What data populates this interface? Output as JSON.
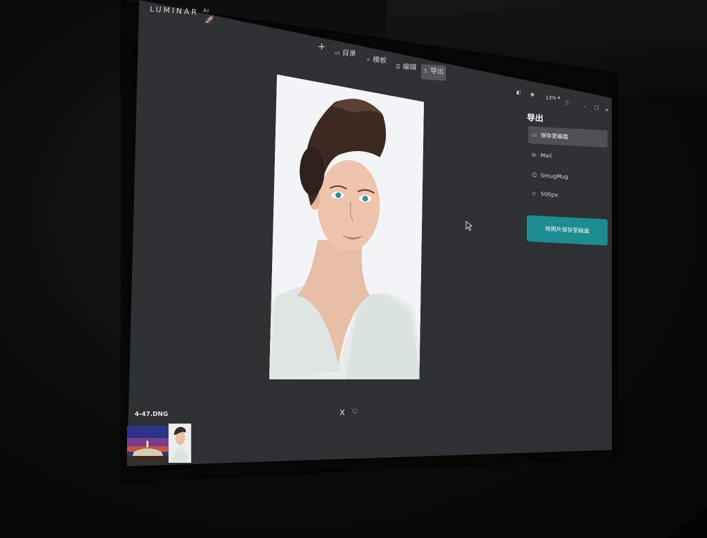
{
  "app": {
    "brand": "LUMINAR",
    "brand_suffix": "AI"
  },
  "nav": {
    "plus": "+",
    "catalog": "目录",
    "template": "模板",
    "edit": "编辑",
    "export": "导出"
  },
  "window_controls": {
    "zoom": "13%"
  },
  "export_panel": {
    "title": "导出",
    "options": [
      {
        "label": "保存至磁盘"
      },
      {
        "label": "Mail"
      },
      {
        "label": "SmugMug"
      },
      {
        "label": "500px"
      }
    ],
    "save_button": "将照片保存至磁盘"
  },
  "filmstrip": {
    "filename": "4-47.DNG",
    "reject": "X"
  },
  "colors": {
    "accent": "#1d8d91",
    "background": "#2e3134",
    "selected": "#4d5155"
  }
}
